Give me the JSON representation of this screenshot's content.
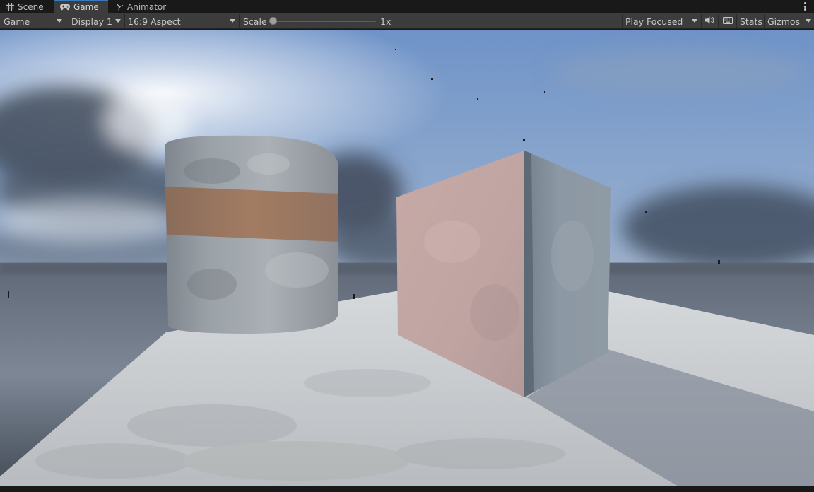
{
  "tabs": [
    {
      "label": "Scene",
      "icon": "grid-icon"
    },
    {
      "label": "Game",
      "icon": "gamepad-icon"
    },
    {
      "label": "Animator",
      "icon": "animator-icon"
    }
  ],
  "toolbar": {
    "view_select": "Game",
    "display_select": "Display 1",
    "aspect_select": "16:9 Aspect",
    "scale_label": "Scale",
    "scale_value": 0.0,
    "scale_text": "1x",
    "play_mode_select": "Play Focused",
    "stats_label": "Stats",
    "gizmos_label": "Gizmos"
  },
  "colors": {
    "panel": "#3c3c3c",
    "tab_strip": "#191919",
    "active_tab_accent": "#3a79bb",
    "sky_top": "#6f93c8",
    "floor": "#c9ccd0"
  }
}
